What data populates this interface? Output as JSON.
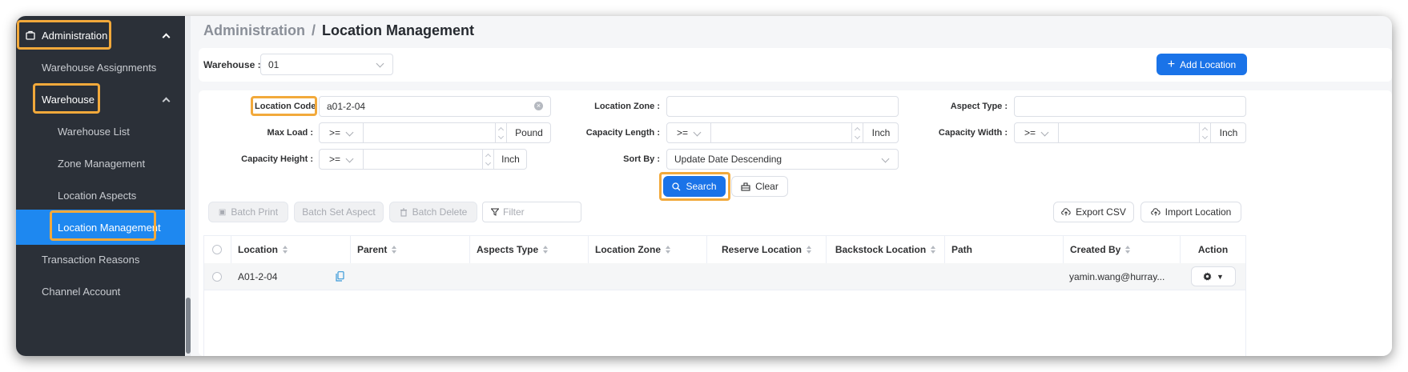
{
  "sidebar": {
    "administration": "Administration",
    "warehouse_assignments": "Warehouse Assignments",
    "warehouse": "Warehouse",
    "warehouse_list": "Warehouse List",
    "zone_management": "Zone Management",
    "location_aspects": "Location Aspects",
    "location_management": "Location Management",
    "transaction_reasons": "Transaction Reasons",
    "channel_account": "Channel Account"
  },
  "breadcrumb": {
    "parent": "Administration",
    "sep": "/",
    "current": "Location Management"
  },
  "warehouse_bar": {
    "label": "Warehouse :",
    "value": "01",
    "add_label": "Add Location"
  },
  "filters": {
    "location_code": {
      "label": "Location Code :",
      "value": "a01-2-04"
    },
    "location_zone": {
      "label": "Location Zone :",
      "value": ""
    },
    "aspect_type": {
      "label": "Aspect Type :",
      "value": ""
    },
    "max_load": {
      "label": "Max Load :",
      "op": ">=",
      "value": "",
      "unit": "Pound"
    },
    "capacity_length": {
      "label": "Capacity Length :",
      "op": ">=",
      "value": "",
      "unit": "Inch"
    },
    "capacity_width": {
      "label": "Capacity Width :",
      "op": ">=",
      "value": "",
      "unit": "Inch"
    },
    "capacity_height": {
      "label": "Capacity Height :",
      "op": ">=",
      "value": "",
      "unit": "Inch"
    },
    "sort_by": {
      "label": "Sort By :",
      "value": "Update Date Descending"
    },
    "search_label": "Search",
    "clear_label": "Clear"
  },
  "toolbar": {
    "batch_print": "Batch Print",
    "batch_set_aspect": "Batch Set Aspect",
    "batch_delete": "Batch Delete",
    "filter_placeholder": "Filter",
    "export_csv": "Export CSV",
    "import_location": "Import Location"
  },
  "table": {
    "columns": [
      "Location",
      "Parent",
      "Aspects Type",
      "Location Zone",
      "Reserve Location",
      "Backstock Location",
      "Path",
      "Created By",
      "Action"
    ],
    "rows": [
      {
        "location": "A01-2-04",
        "parent": "",
        "aspects_type": "",
        "location_zone": "",
        "reserve_location": "",
        "backstock_location": "",
        "path": "",
        "created_by": "yamin.wang@hurray..."
      }
    ]
  },
  "colors": {
    "accent": "#1a73e8",
    "sidebar_bg": "#2b3038",
    "sidebar_active": "#1e88f0",
    "highlight": "#f2a93b"
  }
}
